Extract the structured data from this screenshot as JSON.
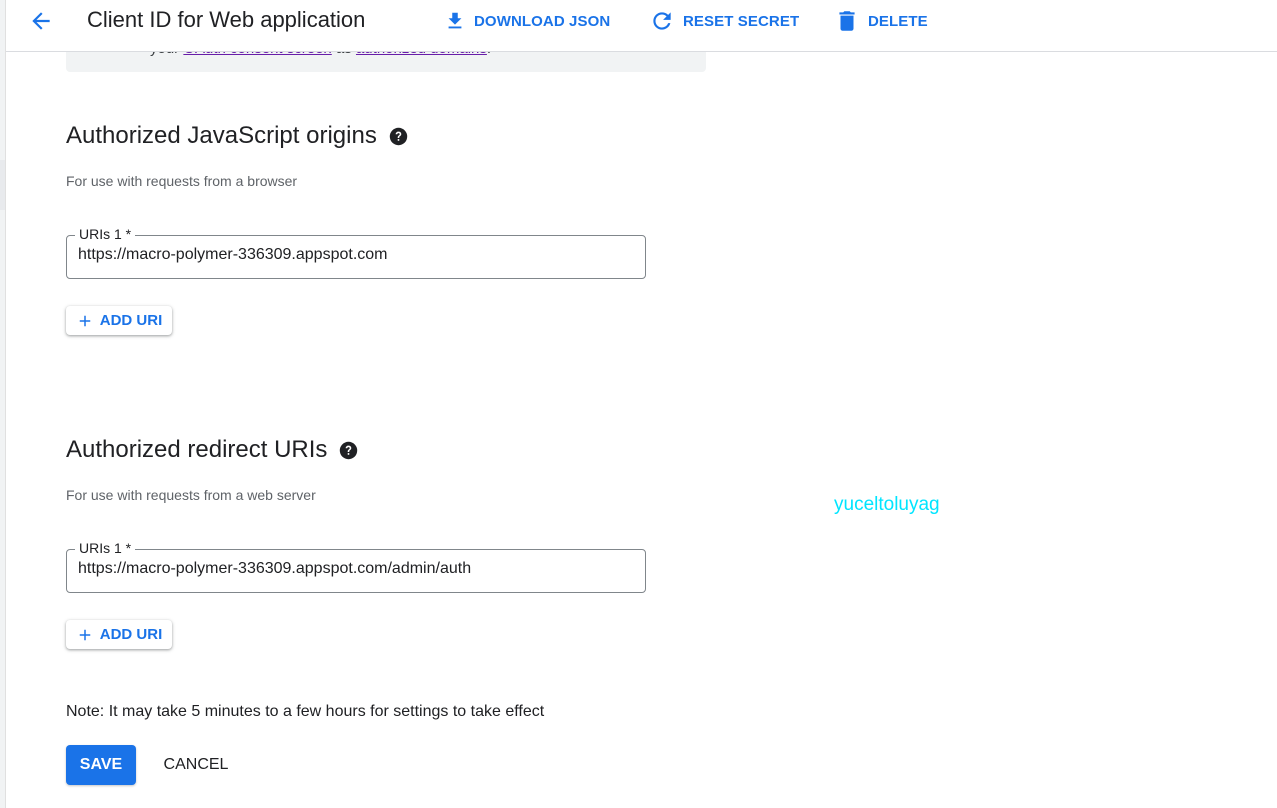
{
  "header": {
    "back_icon": "arrow-back-icon",
    "title": "Client ID for Web application",
    "actions": [
      {
        "label": "DOWNLOAD JSON",
        "icon": "download-icon"
      },
      {
        "label": "RESET SECRET",
        "icon": "refresh-icon"
      },
      {
        "label": "DELETE",
        "icon": "trash-icon"
      }
    ]
  },
  "info_box": {
    "prefix": "your",
    "link1": "OAuth consent screen",
    "middle": "as",
    "link2": "authorized domains",
    "suffix": "."
  },
  "js_origins": {
    "title": "Authorized JavaScript origins",
    "help_icon": "help-icon",
    "subtitle": "For use with requests from a browser",
    "uri_label": "URIs 1 *",
    "uri_value": "https://macro-polymer-336309.appspot.com",
    "add_label": "ADD URI"
  },
  "redirect_uris": {
    "title": "Authorized redirect URIs",
    "help_icon": "help-icon",
    "subtitle": "For use with requests from a web server",
    "uri_label": "URIs 1 *",
    "uri_value": "https://macro-polymer-336309.appspot.com/admin/auth",
    "add_label": "ADD URI"
  },
  "watermark": "yuceltoluyag",
  "note": "Note: It may take 5 minutes to a few hours for settings to take effect",
  "buttons": {
    "save": "SAVE",
    "cancel": "CANCEL"
  },
  "colors": {
    "accent": "#1a73e8",
    "watermark": "#00e5ff",
    "link_visited": "#681da8"
  }
}
